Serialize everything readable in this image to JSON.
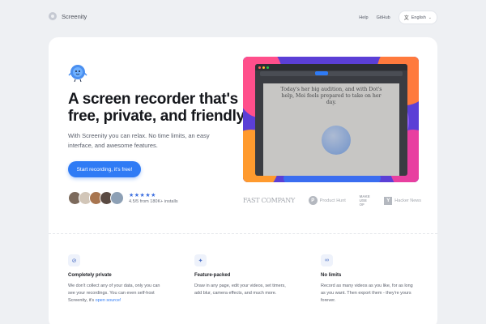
{
  "brand": {
    "name": "Screenity"
  },
  "nav": {
    "help": "Help",
    "github": "GitHub",
    "language": "English"
  },
  "hero": {
    "headline": "A screen recorder that's free, private, and friendly",
    "subtext": "With Screenity you can relax. No time limits, an easy interface, and awesome features.",
    "cta_label": "Start recording, it's free!",
    "stars": "★★★★★",
    "rating_text": "4.5/5 from 180K+ installs",
    "preview_text": "Today's her big audition, and with Dot's help, Mei feels prepared to take on her day."
  },
  "press": {
    "fastcompany": "FAST COMPANY",
    "producthunt_letter": "P",
    "producthunt": "Product Hunt",
    "makeuseof": "MAKE USE OF",
    "hackernews_letter": "Y",
    "hackernews": "Hacker News"
  },
  "features": [
    {
      "icon": "eye-off-icon",
      "glyph": "⊘",
      "title": "Completely private",
      "desc": "We don't collect any of your data, only you can see your recordings. You can even self-host Screenity, it's",
      "link": "open source!"
    },
    {
      "icon": "sparkle-icon",
      "glyph": "✦",
      "title": "Feature-packed",
      "desc": "Draw in any page, edit your videos, set timers, add blur, camera effects, and much more."
    },
    {
      "icon": "infinity-icon",
      "glyph": "∞",
      "title": "No limits",
      "desc": "Record as many videos as you like, for as long as you want. Then export them - they're yours forever."
    }
  ],
  "colors": {
    "accent": "#2f7bf5",
    "background": "#eef0f3",
    "card": "#ffffff"
  }
}
